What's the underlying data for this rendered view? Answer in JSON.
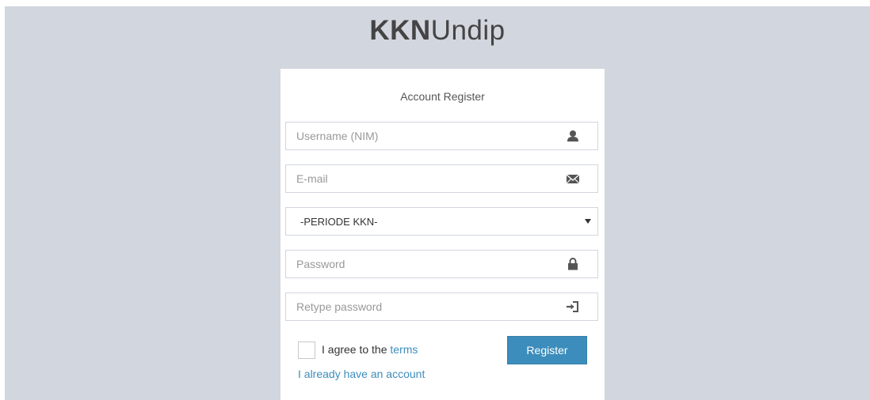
{
  "logo": {
    "bold": "KKN",
    "light": "Undip"
  },
  "box_msg": "Account Register",
  "fields": {
    "username": {
      "placeholder": "Username (NIM)",
      "icon": "user-icon"
    },
    "email": {
      "placeholder": "E-mail",
      "icon": "envelope-icon"
    },
    "periode": {
      "selected": "-PERIODE KKN-"
    },
    "password": {
      "placeholder": "Password",
      "icon": "lock-icon"
    },
    "retype": {
      "placeholder": "Retype password",
      "icon": "log-in-icon"
    }
  },
  "agree": {
    "text": "I agree to the ",
    "link": "terms"
  },
  "register_button": "Register",
  "login_link": "I already have an account",
  "colors": {
    "background": "#d2d6de",
    "accent": "#3c8dbc",
    "box": "#ffffff"
  }
}
